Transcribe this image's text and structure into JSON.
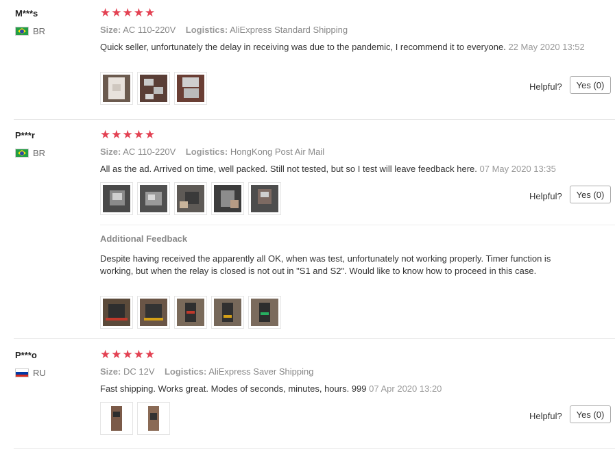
{
  "reviews": [
    {
      "user": "M***s",
      "country": "BR",
      "stars": "★★★★★",
      "size_label": "Size:",
      "size_value": "AC 110-220V",
      "logistics_label": "Logistics:",
      "logistics_value": "AliExpress Standard Shipping",
      "text": "Quick seller, unfortunately the delay in receiving was due to the pandemic, I recommend it to everyone.",
      "date": "22 May 2020 13:52",
      "helpful_label": "Helpful?",
      "yes_label": "Yes (0)"
    },
    {
      "user": "P***r",
      "country": "BR",
      "stars": "★★★★★",
      "size_label": "Size:",
      "size_value": "AC 110-220V",
      "logistics_label": "Logistics:",
      "logistics_value": "HongKong Post Air Mail",
      "text": "All as the ad. Arrived on time, well packed. Still not tested, but so I test will leave feedback here.",
      "date": "07 May 2020 13:35",
      "helpful_label": "Helpful?",
      "yes_label": "Yes (0)",
      "additional_title": "Additional Feedback",
      "additional_text": "Despite having received the apparently all OK, when was test, unfortunately not working properly. Timer function is working, but when the relay is closed is not out in \"S1 and S2\". Would like to know how to proceed in this case."
    },
    {
      "user": "P***o",
      "country": "RU",
      "stars": "★★★★★",
      "size_label": "Size:",
      "size_value": "DC 12V",
      "logistics_label": "Logistics:",
      "logistics_value": "AliExpress Saver Shipping",
      "text": "Fast shipping. Works great. Modes of seconds, minutes, hours. 999",
      "date": "07 Apr 2020 13:20",
      "helpful_label": "Helpful?",
      "yes_label": "Yes (0)"
    }
  ],
  "colors": {
    "star": "#e34253",
    "muted": "#999999",
    "text": "#333333"
  }
}
